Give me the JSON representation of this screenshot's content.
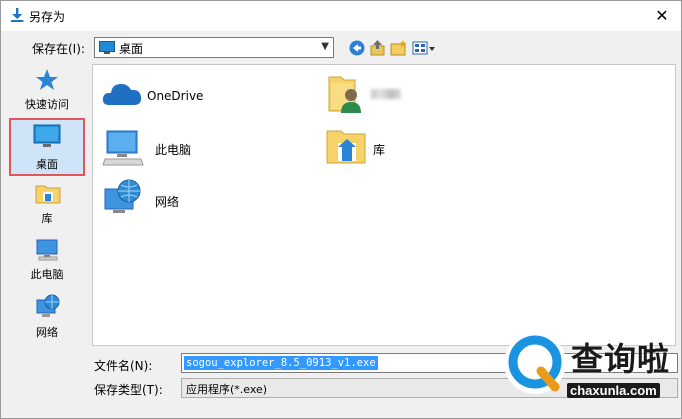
{
  "window": {
    "title": "另存为"
  },
  "location": {
    "label": "保存在(I):",
    "value": "桌面"
  },
  "nav": {
    "items": [
      {
        "label": "快速访问"
      },
      {
        "label": "桌面"
      },
      {
        "label": "库"
      },
      {
        "label": "此电脑"
      },
      {
        "label": "网络"
      }
    ],
    "selected": "桌面"
  },
  "list": {
    "items": [
      {
        "label": "OneDrive",
        "icon": "onedrive-cloud-icon"
      },
      {
        "label": "",
        "icon": "user-folder-icon"
      },
      {
        "label": "此电脑",
        "icon": "computer-icon"
      },
      {
        "label": "库",
        "icon": "library-folder-icon"
      },
      {
        "label": "网络",
        "icon": "network-icon"
      }
    ]
  },
  "form": {
    "filename_label": "文件名(N):",
    "filename_value": "sogou_explorer_8.5_0913_v1.exe",
    "type_label": "保存类型(T):",
    "type_value": "应用程序(*.exe)"
  },
  "watermark": {
    "cn": "查询啦",
    "en": "chaxunla.com"
  },
  "colors": {
    "accent": "#3399ff",
    "selection_border": "#e0565a",
    "folder": "#f6d26b"
  }
}
